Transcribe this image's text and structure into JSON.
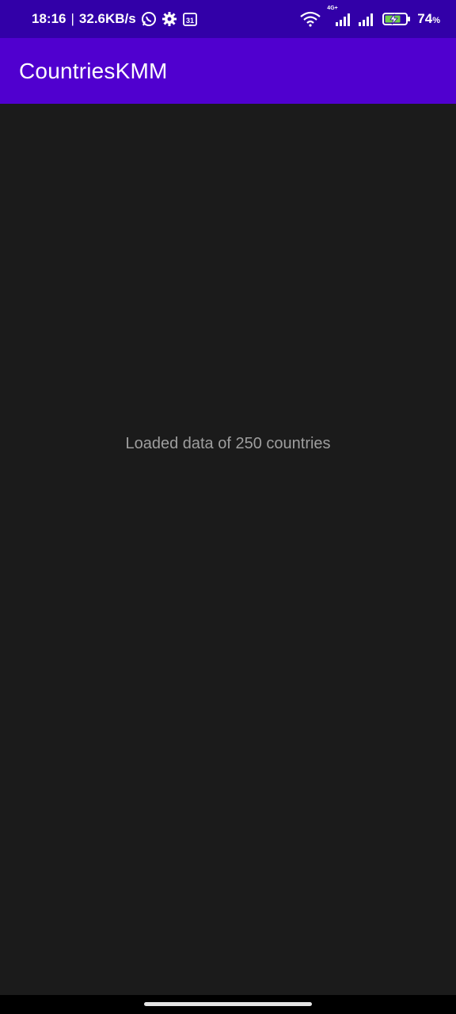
{
  "status_bar": {
    "time": "18:16",
    "separator": "|",
    "net_speed": "32.6KB/s",
    "network_label": "4G+",
    "battery_percent": "74",
    "battery_unit": "%",
    "icons": [
      "whatsapp-icon",
      "settings-gear-icon",
      "calendar-31-icon",
      "wifi-icon",
      "signal-4g-icon",
      "signal-icon",
      "battery-charging-icon"
    ]
  },
  "app_bar": {
    "title": "CountriesKMM"
  },
  "main": {
    "message": "Loaded data of 250 countries"
  },
  "colors": {
    "status_bar": "#3200a8",
    "app_bar": "#5000cf",
    "background": "#1b1b1b",
    "message_text": "#9e9e9e"
  }
}
